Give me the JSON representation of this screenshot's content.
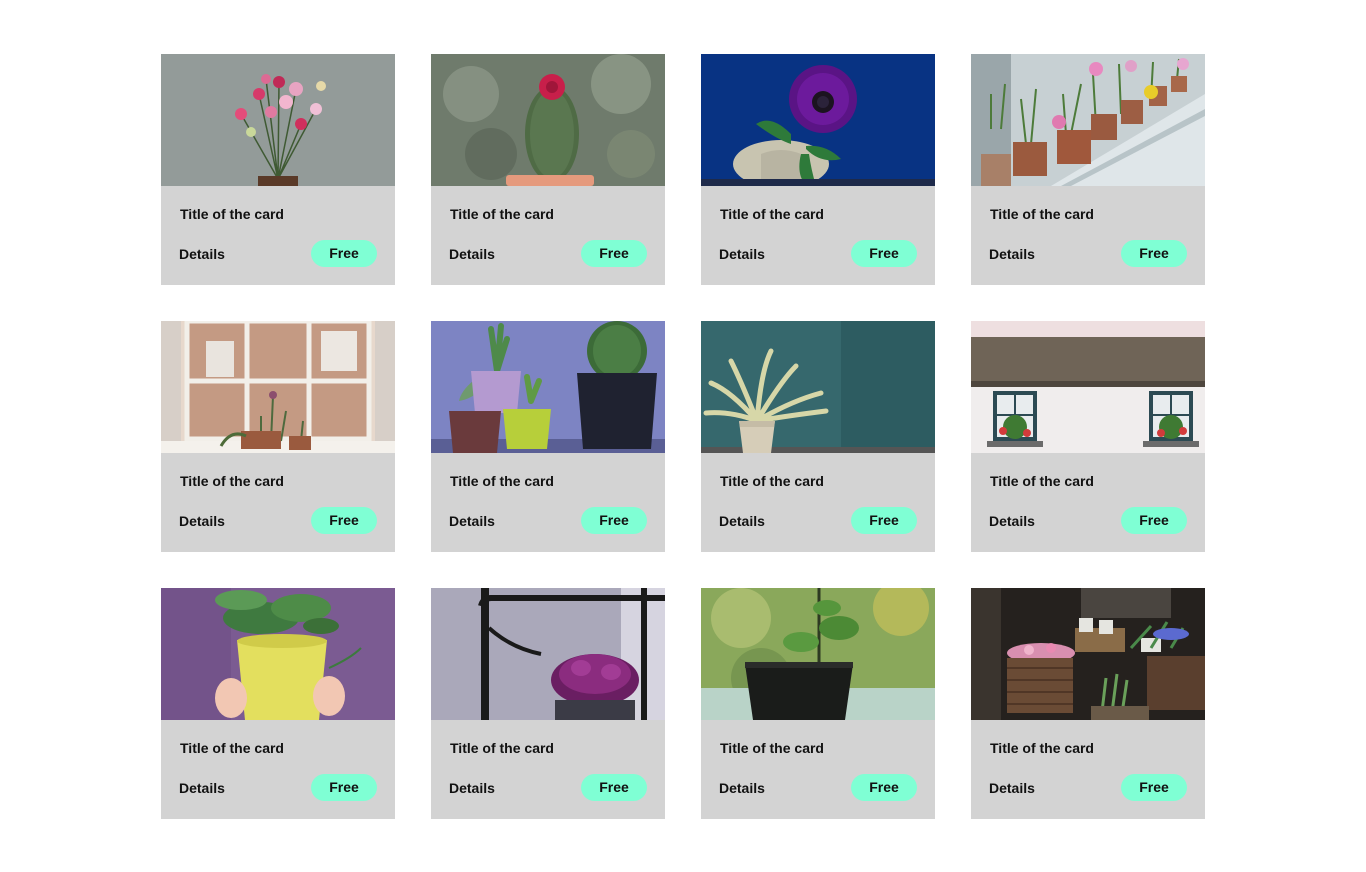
{
  "cards": [
    {
      "title": "Title of the card",
      "details_label": "Details",
      "badge": "Free",
      "image": "carnation-bouquet-photo",
      "bg": "#8a9290"
    },
    {
      "title": "Title of the card",
      "details_label": "Details",
      "badge": "Free",
      "image": "cactus-flower-photo",
      "bg": "#6f7a6c"
    },
    {
      "title": "Title of the card",
      "details_label": "Details",
      "badge": "Free",
      "image": "purple-anemone-photo",
      "bg": "#0b3a8c"
    },
    {
      "title": "Title of the card",
      "details_label": "Details",
      "badge": "Free",
      "image": "windowsill-pots-photo",
      "bg": "#c8d0d2"
    },
    {
      "title": "Title of the card",
      "details_label": "Details",
      "badge": "Free",
      "image": "window-plants-photo",
      "bg": "#c9a693"
    },
    {
      "title": "Title of the card",
      "details_label": "Details",
      "badge": "Free",
      "image": "succulents-colored-pots-photo",
      "bg": "#7f86c4"
    },
    {
      "title": "Title of the card",
      "details_label": "Details",
      "badge": "Free",
      "image": "fern-teal-wall-photo",
      "bg": "#2f5d62"
    },
    {
      "title": "Title of the card",
      "details_label": "Details",
      "badge": "Free",
      "image": "cottage-window-boxes-photo",
      "bg": "#ece8e8"
    },
    {
      "title": "Title of the card",
      "details_label": "Details",
      "badge": "Free",
      "image": "hands-yellow-pot-photo",
      "bg": "#7a5a91"
    },
    {
      "title": "Title of the card",
      "details_label": "Details",
      "badge": "Free",
      "image": "purple-flowers-railing-photo",
      "bg": "#a9a7b8"
    },
    {
      "title": "Title of the card",
      "details_label": "Details",
      "badge": "Free",
      "image": "black-pot-green-bokeh-photo",
      "bg": "#8fa85a"
    },
    {
      "title": "Title of the card",
      "details_label": "Details",
      "badge": "Free",
      "image": "flower-shop-baskets-photo",
      "bg": "#2a2622"
    }
  ],
  "colors": {
    "card_bg": "#d3d3d3",
    "badge_bg": "#7fffd4",
    "page_bg": "#ffffff"
  }
}
